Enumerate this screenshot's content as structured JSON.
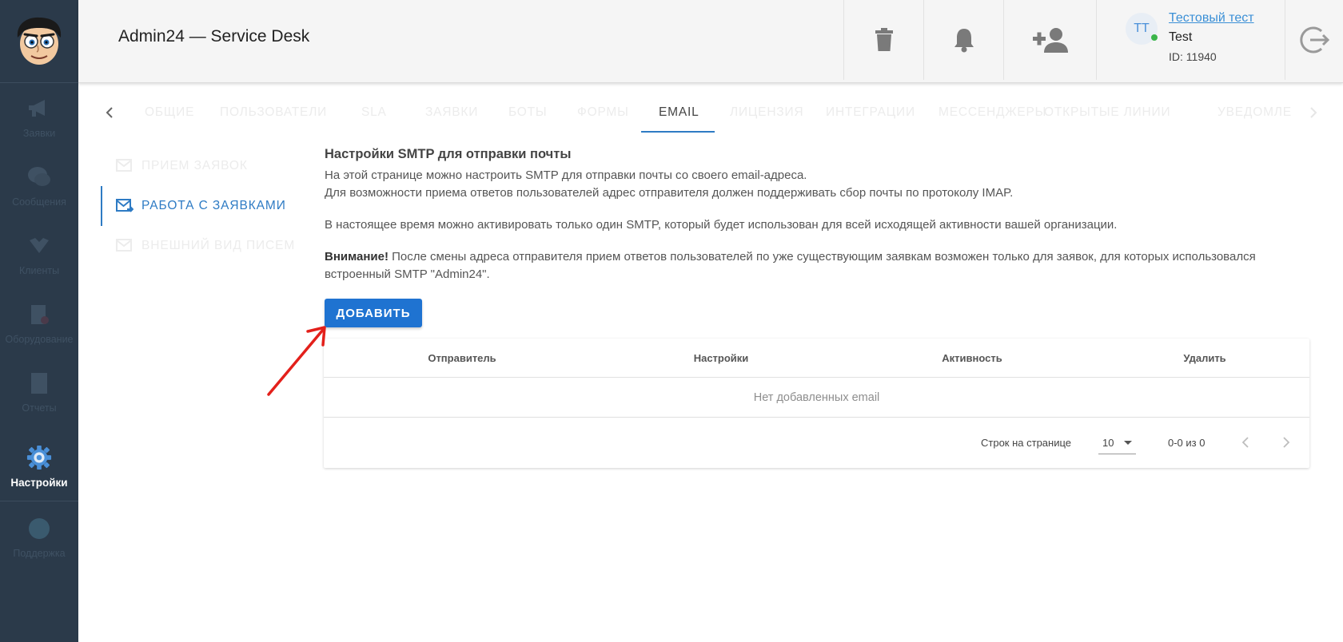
{
  "header": {
    "title": "Admin24 — Service Desk",
    "user": {
      "initials": "ТТ",
      "name": "Тестовый тест",
      "subtitle": "Test",
      "id_label": "ID: 11940"
    }
  },
  "sidebar": {
    "items": [
      {
        "label": "Заявки",
        "icon": "megaphone-icon"
      },
      {
        "label": "Сообщения",
        "icon": "chat-icon"
      },
      {
        "label": "Клиенты",
        "icon": "clients-icon"
      },
      {
        "label": "Оборудование",
        "icon": "equipment-icon"
      },
      {
        "label": "Отчеты",
        "icon": "report-icon"
      },
      {
        "label": "Настройки",
        "icon": "gear-icon"
      },
      {
        "label": "Поддержка",
        "icon": "support-icon"
      }
    ]
  },
  "tabs": [
    {
      "label": "Общие"
    },
    {
      "label": "Пользователи"
    },
    {
      "label": "SLA"
    },
    {
      "label": "Заявки"
    },
    {
      "label": "Боты"
    },
    {
      "label": "Формы"
    },
    {
      "label": "Email"
    },
    {
      "label": "Лицензия"
    },
    {
      "label": "Интеграции"
    },
    {
      "label": "Мессенджеры"
    },
    {
      "label": "Открытые линии"
    },
    {
      "label": "Уведомлен"
    }
  ],
  "submenu": [
    {
      "label": "Прием заявок"
    },
    {
      "label": "Работа с заявками"
    },
    {
      "label": "Внешний вид писем"
    }
  ],
  "content": {
    "title": "Настройки SMTP для отправки почты",
    "line1": "На этой странице можно настроить SMTP для отправки почты со своего email-адреса.",
    "line2": "Для возможности приема ответов пользователей адрес отправителя должен поддерживать сбор почты по протоколу IMAP.",
    "line3": "В настоящее время можно активировать только один SMTP, который будет использован для всей исходящей активности вашей организации.",
    "warning_label": "Внимание!",
    "warning_text": " После смены адреса отправителя прием ответов пользователей по уже существующим заявкам возможен только для заявок, для которых использовался встроенный SMTP \"Admin24\".",
    "add_button": "ДОБАВИТЬ"
  },
  "table": {
    "columns": [
      "Отправитель",
      "Настройки",
      "Активность",
      "Удалить"
    ],
    "empty_text": "Нет добавленных email",
    "rows_per_page_label": "Строк на странице",
    "rows_per_page_value": "10",
    "range_label": "0-0 из 0"
  },
  "colors": {
    "sidebar_bg": "#2b3a4a",
    "accent": "#2e7bc4",
    "button": "#1f73d1",
    "annotation_arrow": "#e3201b"
  }
}
